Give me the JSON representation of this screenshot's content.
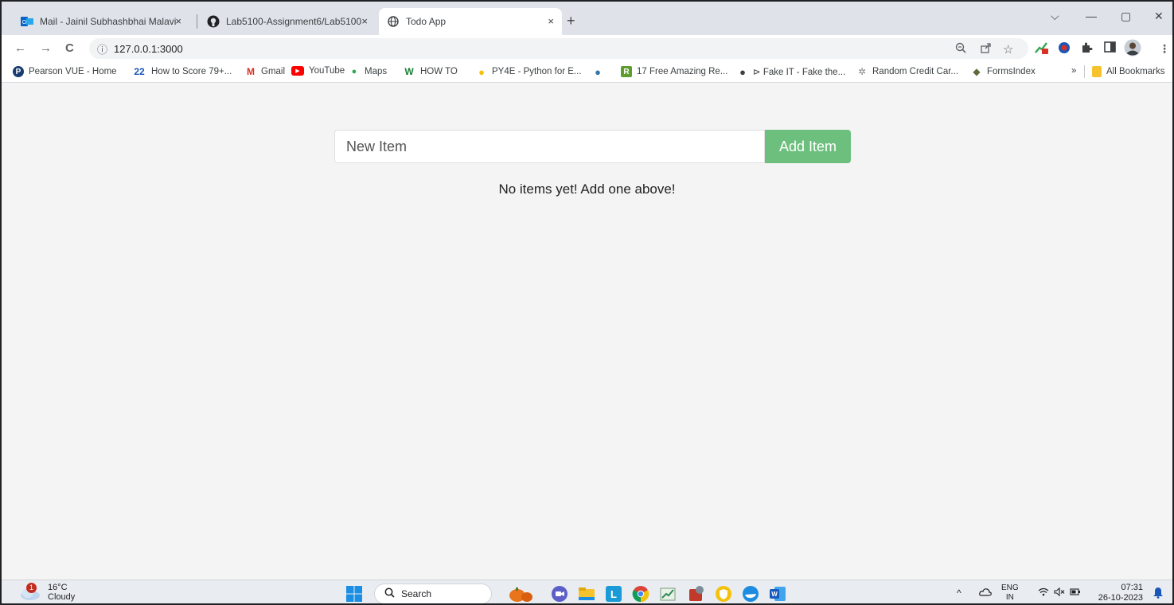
{
  "browser": {
    "tabs": [
      {
        "title": "Mail - Jainil Subhashbhai Malavi",
        "close": "×"
      },
      {
        "title": "Lab5100-Assignment6/Lab5100",
        "close": "×"
      },
      {
        "title": "Todo App",
        "close": "×"
      }
    ],
    "new_tab": "+",
    "window_controls": {
      "dropdown": "⌵",
      "minimize": "—",
      "restore": "▢",
      "close": "✕"
    },
    "nav": {
      "back": "←",
      "forward": "→",
      "reload": "C"
    },
    "address": {
      "info_icon": "ⓘ",
      "url": "127.0.0.1:3000"
    },
    "bookmarks": [
      {
        "label": "Pearson VUE - Home",
        "icon": "P"
      },
      {
        "label": "How to Score 79+...",
        "icon": "22"
      },
      {
        "label": "Gmail",
        "icon": "M"
      },
      {
        "label": "YouTube",
        "icon": "▶"
      },
      {
        "label": "Maps",
        "icon": "●"
      },
      {
        "label": "HOW TO",
        "icon": "W"
      },
      {
        "label": "PY4E - Python for E...",
        "icon": "●"
      },
      {
        "label": "",
        "icon": "●"
      },
      {
        "label": "17 Free Amazing Re...",
        "icon": "R"
      },
      {
        "label": "⊳ Fake IT - Fake the...",
        "icon": "●"
      },
      {
        "label": "Random Credit Car...",
        "icon": "✲"
      },
      {
        "label": "FormsIndex",
        "icon": "◆"
      }
    ],
    "bookmarks_overflow": "»",
    "all_bookmarks": "All Bookmarks"
  },
  "app": {
    "input_placeholder": "New Item",
    "add_button": "Add Item",
    "empty_message": "No items yet! Add one above!"
  },
  "taskbar": {
    "weather_temp": "16°C",
    "weather_desc": "Cloudy",
    "weather_badge": "1",
    "search_label": "Search",
    "lang_top": "ENG",
    "lang_bottom": "IN",
    "time": "07:31",
    "date": "26-10-2023"
  },
  "colors": {
    "add_button": "#6cbf7c",
    "page_bg": "#f4f4f4",
    "tabstrip_bg": "#dfe3e9",
    "taskbar_bg": "#e9edf2"
  }
}
